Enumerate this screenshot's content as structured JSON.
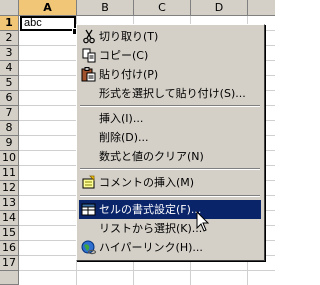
{
  "spreadsheet": {
    "columns": [
      "A",
      "B",
      "C",
      "D"
    ],
    "rows": [
      "1",
      "2",
      "3",
      "4",
      "5",
      "6",
      "7",
      "8",
      "9",
      "10",
      "11",
      "12",
      "13",
      "14",
      "15",
      "16",
      "17"
    ],
    "selected_cell_value": "abc"
  },
  "context_menu": {
    "items": [
      {
        "label": "切り取り(T)",
        "icon": "scissors-icon"
      },
      {
        "label": "コピー(C)",
        "icon": "copy-icon"
      },
      {
        "label": "貼り付け(P)",
        "icon": "paste-icon"
      },
      {
        "label": "形式を選択して貼り付け(S)...",
        "icon": ""
      },
      {
        "label": "挿入(I)...",
        "icon": ""
      },
      {
        "label": "削除(D)...",
        "icon": ""
      },
      {
        "label": "数式と値のクリア(N)",
        "icon": ""
      },
      {
        "label": "コメントの挿入(M)",
        "icon": "comment-icon"
      },
      {
        "label": "セルの書式設定(F)...",
        "icon": "format-cells-icon"
      },
      {
        "label": "リストから選択(K)...",
        "icon": ""
      },
      {
        "label": "ハイパーリンク(H)...",
        "icon": "hyperlink-icon"
      }
    ]
  },
  "colors": {
    "header_bg": "#d4d0c8",
    "selected_header_bg": "#f2c677",
    "menu_highlight": "#0a246a"
  }
}
